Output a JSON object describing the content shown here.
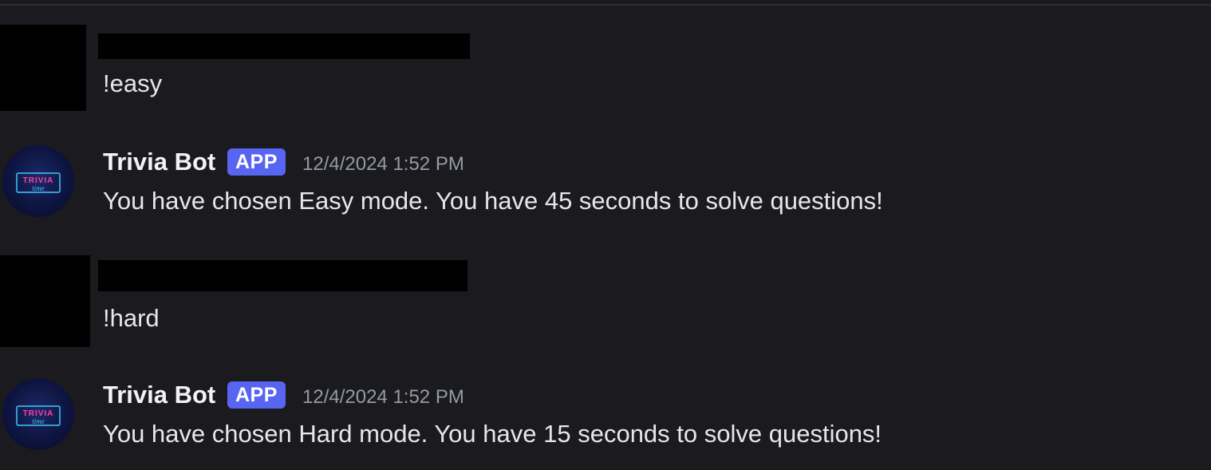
{
  "messages": [
    {
      "type": "user",
      "content": "!easy"
    },
    {
      "type": "bot",
      "author": "Trivia Bot",
      "tag": "APP",
      "timestamp": "12/4/2024 1:52 PM",
      "content": "You have chosen Easy mode. You have 45 seconds to solve questions!"
    },
    {
      "type": "user",
      "content": "!hard"
    },
    {
      "type": "bot",
      "author": "Trivia Bot",
      "tag": "APP",
      "timestamp": "12/4/2024 1:52 PM",
      "content": "You have chosen Hard mode. You have 15 seconds to solve questions!"
    }
  ],
  "bot_avatar": {
    "icon": "trivia-time-neon-logo",
    "text_top": "TRIVIA",
    "text_bottom": "time"
  },
  "colors": {
    "background": "#1b1b1f",
    "app_tag": "#5865f2",
    "timestamp": "#949ba4",
    "text": "#e6e7ea",
    "neon_pink": "#ff3fa4",
    "neon_blue": "#3fc8ff"
  }
}
